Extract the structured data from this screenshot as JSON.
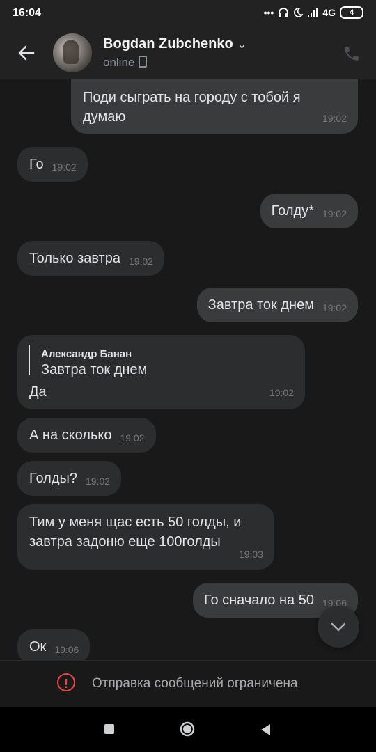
{
  "statusbar": {
    "time": "16:04",
    "network": "4G",
    "battery": "4"
  },
  "header": {
    "name": "Bogdan Zubchenko",
    "status": "online"
  },
  "messages": [
    {
      "text": "Поди сыграть на городу с тобой я думаю",
      "time": "19:02"
    },
    {
      "text": "Го",
      "time": "19:02"
    },
    {
      "text": "Голду*",
      "time": "19:02"
    },
    {
      "text": "Только завтра",
      "time": "19:02"
    },
    {
      "text": "Завтра ток днем",
      "time": "19:02"
    },
    {
      "reply_author": "Александр Банан",
      "reply_text": "Завтра ток днем",
      "text": "Да",
      "time": "19:02"
    },
    {
      "text": "А на сколько",
      "time": "19:02"
    },
    {
      "text": "Голды?",
      "time": "19:02"
    },
    {
      "text": "Тим у меня щас есть 50 голды, и завтра задоню еще 100голды",
      "time": "19:03"
    },
    {
      "text": "Го сначало на 50",
      "time": "19:06"
    },
    {
      "text": "Ок",
      "time": "19:06"
    }
  ],
  "restriction": {
    "text": "Отправка сообщений ограничена"
  },
  "icons": {
    "back": "arrow-left-icon",
    "call": "phone-icon",
    "scroll": "chevron-down-icon",
    "warning": "exclamation-circle-icon"
  },
  "colors": {
    "background": "#19191a",
    "bubble_in": "#2c2d2e",
    "bubble_out": "#3a3b3d",
    "warning": "#e64646"
  }
}
